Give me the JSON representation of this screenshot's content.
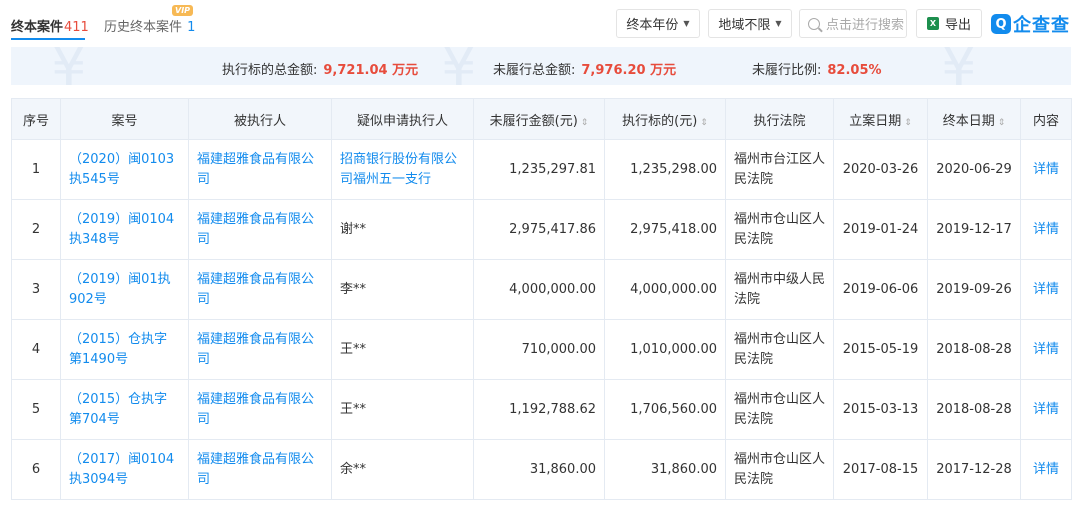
{
  "tabs": {
    "active": {
      "label": "终本案件",
      "count": "411"
    },
    "history": {
      "label": "历史终本案件",
      "count": "1",
      "badge": "VIP"
    }
  },
  "toolbar": {
    "year_filter": "终本年份",
    "region_filter": "地域不限",
    "search_placeholder": "点击进行搜索",
    "export_label": "导出",
    "logo_text": "企查查"
  },
  "summary": {
    "total_label": "执行标的总金额:",
    "total_value": "9,721.04 万元",
    "unfulfilled_label": "未履行总金额:",
    "unfulfilled_value": "7,976.20 万元",
    "ratio_label": "未履行比例:",
    "ratio_value": "82.05%"
  },
  "table": {
    "headers": [
      "序号",
      "案号",
      "被执行人",
      "疑似申请执行人",
      "未履行金额(元)",
      "执行标的(元)",
      "执行法院",
      "立案日期",
      "终本日期",
      "内容"
    ],
    "rows": [
      {
        "no": "1",
        "case": "（2020）闽0103执545号",
        "executee": "福建超雅食品有限公司",
        "applicant": "招商银行股份有限公司福州五一支行",
        "unfulfilled": "1,235,297.81",
        "target": "1,235,298.00",
        "court": "福州市台江区人民法院",
        "filed": "2020-03-26",
        "ended": "2020-06-29",
        "action": "详情"
      },
      {
        "no": "2",
        "case": "（2019）闽0104执348号",
        "executee": "福建超雅食品有限公司",
        "applicant": "谢**",
        "unfulfilled": "2,975,417.86",
        "target": "2,975,418.00",
        "court": "福州市仓山区人民法院",
        "filed": "2019-01-24",
        "ended": "2019-12-17",
        "action": "详情"
      },
      {
        "no": "3",
        "case": "（2019）闽01执902号",
        "executee": "福建超雅食品有限公司",
        "applicant": "李**",
        "unfulfilled": "4,000,000.00",
        "target": "4,000,000.00",
        "court": "福州市中级人民法院",
        "filed": "2019-06-06",
        "ended": "2019-09-26",
        "action": "详情"
      },
      {
        "no": "4",
        "case": "（2015）仓执字第1490号",
        "executee": "福建超雅食品有限公司",
        "applicant": "王**",
        "unfulfilled": "710,000.00",
        "target": "1,010,000.00",
        "court": "福州市仓山区人民法院",
        "filed": "2015-05-19",
        "ended": "2018-08-28",
        "action": "详情"
      },
      {
        "no": "5",
        "case": "（2015）仓执字第704号",
        "executee": "福建超雅食品有限公司",
        "applicant": "王**",
        "unfulfilled": "1,192,788.62",
        "target": "1,706,560.00",
        "court": "福州市仓山区人民法院",
        "filed": "2015-03-13",
        "ended": "2018-08-28",
        "action": "详情"
      },
      {
        "no": "6",
        "case": "（2017）闽0104执3094号",
        "executee": "福建超雅食品有限公司",
        "applicant": "余**",
        "unfulfilled": "31,860.00",
        "target": "31,860.00",
        "court": "福州市仓山区人民法院",
        "filed": "2017-08-15",
        "ended": "2017-12-28",
        "action": "详情"
      }
    ]
  }
}
